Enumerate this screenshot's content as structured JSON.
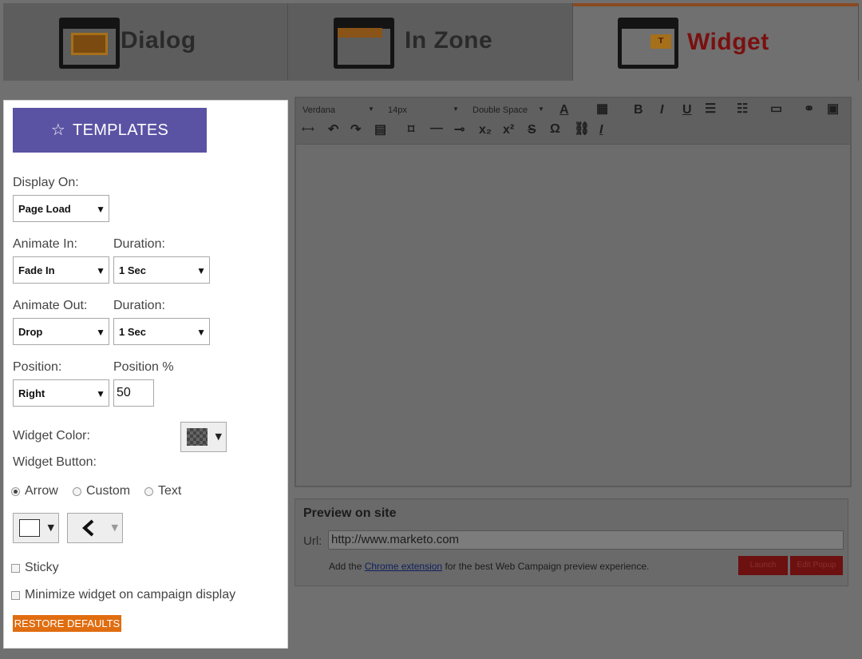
{
  "tabs": [
    {
      "label": "Dialog",
      "icon": "dialog-window-icon",
      "active": false
    },
    {
      "label": "In Zone",
      "icon": "inzone-window-icon",
      "active": false
    },
    {
      "label": "Widget",
      "icon": "widget-window-icon",
      "active": true
    }
  ],
  "panel": {
    "templates_label": "TEMPLATES",
    "display_on": {
      "label": "Display On:",
      "value": "Page Load"
    },
    "animate_in": {
      "label": "Animate In:",
      "value": "Fade In",
      "duration_label": "Duration:",
      "duration_value": "1 Sec"
    },
    "animate_out": {
      "label": "Animate Out:",
      "value": "Drop",
      "duration_label": "Duration:",
      "duration_value": "1 Sec"
    },
    "position": {
      "label": "Position:",
      "value": "Right",
      "percent_label": "Position %",
      "percent_value": "50"
    },
    "widget_color_label": "Widget Color:",
    "widget_button_label": "Widget Button:",
    "button_type_options": [
      "Arrow",
      "Custom",
      "Text"
    ],
    "button_type_selected": "Arrow",
    "sticky_label": "Sticky",
    "minimize_label": "Minimize widget on campaign display",
    "restore_label": "RESTORE DEFAULTS"
  },
  "editor": {
    "font_family": "Verdana",
    "font_size": "14px",
    "line_spacing": "Double Space"
  },
  "preview": {
    "title": "Preview on site",
    "url_label": "Url:",
    "url_value": "http://www.marketo.com",
    "note_prefix": "Add the",
    "note_link": "Chrome extension",
    "note_suffix": "for the best Web Campaign preview experience.",
    "buttons": [
      "Launch",
      "Edit Popup"
    ]
  },
  "colors": {
    "templates_button": "#5a52a3",
    "restore_button": "#e06d10",
    "active_tab_label": "#7a1010"
  }
}
